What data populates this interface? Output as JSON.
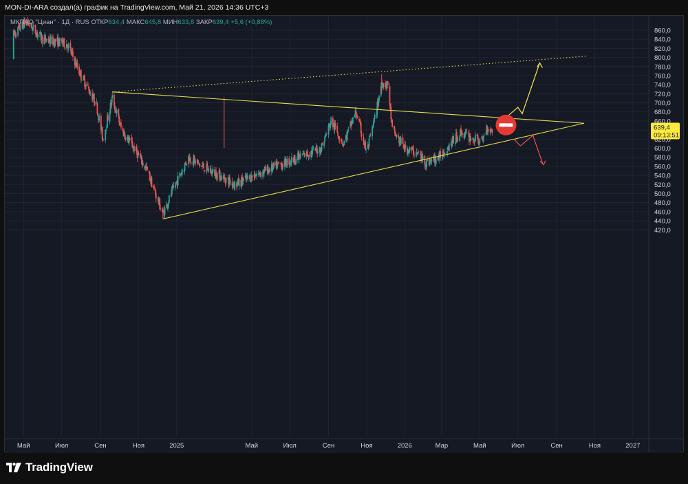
{
  "header": {
    "attribution": "MON-DI-ARA создал(а) график на TradingView.com, Май 21, 2026 14:36 UTC+3"
  },
  "legend": {
    "symbol": "МКПАО \"Циан\" · 1Д · RUS",
    "open_label": "ОТКР",
    "open": "634,4",
    "high_label": "МАКС",
    "high": "645,8",
    "low_label": "МИН",
    "low": "633,8",
    "close_label": "ЗАКР",
    "close": "639,4",
    "change": "+5,6 (+0,88%)"
  },
  "price_badge": {
    "price": "639,4",
    "countdown": "09:13:51",
    "color": "#ffeb3b"
  },
  "brand": {
    "name": "TradingView"
  },
  "colors": {
    "up": "#26a69a",
    "down": "#ef5350",
    "lines": "#e8dc4a",
    "up_arrow": "#e8dc4a",
    "down_arrow": "#ef5350",
    "stop": "#e53935"
  },
  "chart_data": {
    "type": "candlestick",
    "ylim": [
      410,
      870
    ],
    "y_ticks": [
      "860,0",
      "840,0",
      "820,0",
      "800,0",
      "780,0",
      "760,0",
      "740,0",
      "720,0",
      "700,0",
      "680,0",
      "660,0",
      "640,0",
      "620,0",
      "600,0",
      "580,0",
      "560,0",
      "540,0",
      "520,0",
      "500,0",
      "480,0",
      "460,0",
      "440,0",
      "420,0"
    ],
    "x_ticks": [
      "Май",
      "Июл",
      "Сен",
      "Ноя",
      "2025",
      "Май",
      "Июл",
      "Сен",
      "Ноя",
      "2026",
      "Мар",
      "Май",
      "Июл",
      "Сен",
      "Ноя",
      "2027"
    ],
    "x_range": [
      "2024-04",
      "2027-02"
    ],
    "last_price": 639.4,
    "key_points": [
      {
        "date": "2024-09-20",
        "price": 723
      },
      {
        "date": "2024-12-10",
        "price": 444
      },
      {
        "date": "2025-11-25",
        "price": 763
      },
      {
        "date": "2026-02-05",
        "price": 565
      },
      {
        "date": "2026-05-21",
        "price": 639.4
      }
    ],
    "drawings": {
      "triangle_upper_line": {
        "from": [
          "2024-09-20",
          724
        ],
        "to": [
          "2026-10-15",
          655
        ]
      },
      "triangle_lower_line": {
        "from": [
          "2024-12-10",
          444
        ],
        "to": [
          "2026-10-15",
          655
        ]
      },
      "dotted_resistance": {
        "from": [
          "2024-09-20",
          724
        ],
        "to": [
          "2026-10-20",
          803
        ]
      },
      "bullish_scenario": "up arrow toward ~790",
      "bearish_scenario": "down arrow toward ~565"
    }
  }
}
